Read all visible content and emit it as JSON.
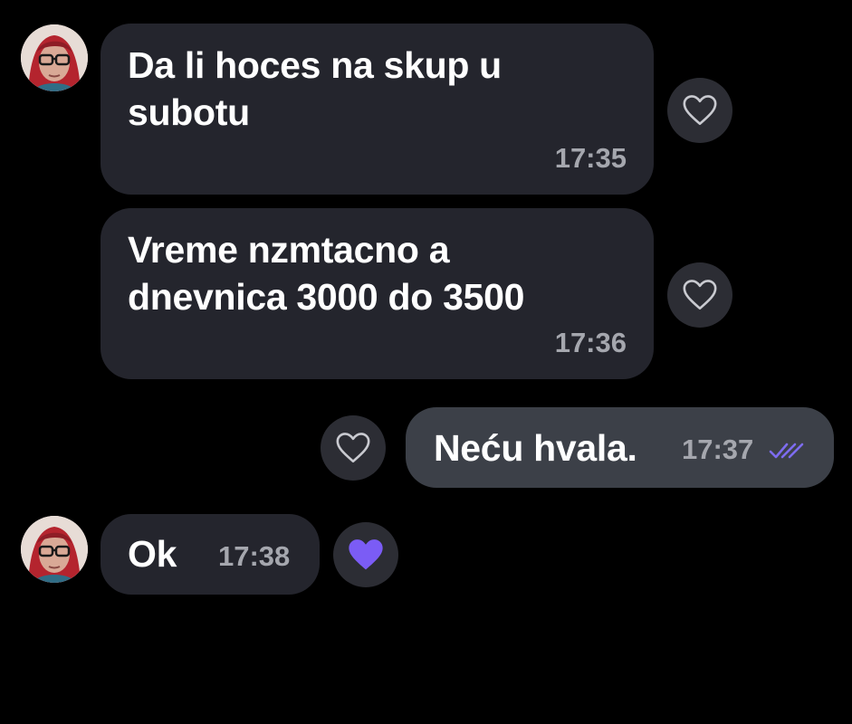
{
  "messages": [
    {
      "direction": "incoming",
      "text": "Da li hoces na skup u\nsubotu",
      "time": "17:35",
      "reaction": "heart-outline"
    },
    {
      "direction": "incoming",
      "text": "Vreme nzmtacno a\ndnevnica 3000 do 3500",
      "time": "17:36",
      "reaction": "heart-outline"
    },
    {
      "direction": "outgoing",
      "text": "Neću hvala.",
      "time": "17:37",
      "status": "double-check-icon",
      "reaction": "heart-outline"
    },
    {
      "direction": "incoming",
      "text": "Ok",
      "time": "17:38",
      "reaction": "heart-filled"
    }
  ],
  "colors": {
    "background": "#000000",
    "incoming_bubble": "#24252d",
    "outgoing_bubble": "#3c4048",
    "reaction_button": "#2c2d34",
    "liked_heart": "#7b5cf5",
    "read_check": "#7d6cf0"
  }
}
